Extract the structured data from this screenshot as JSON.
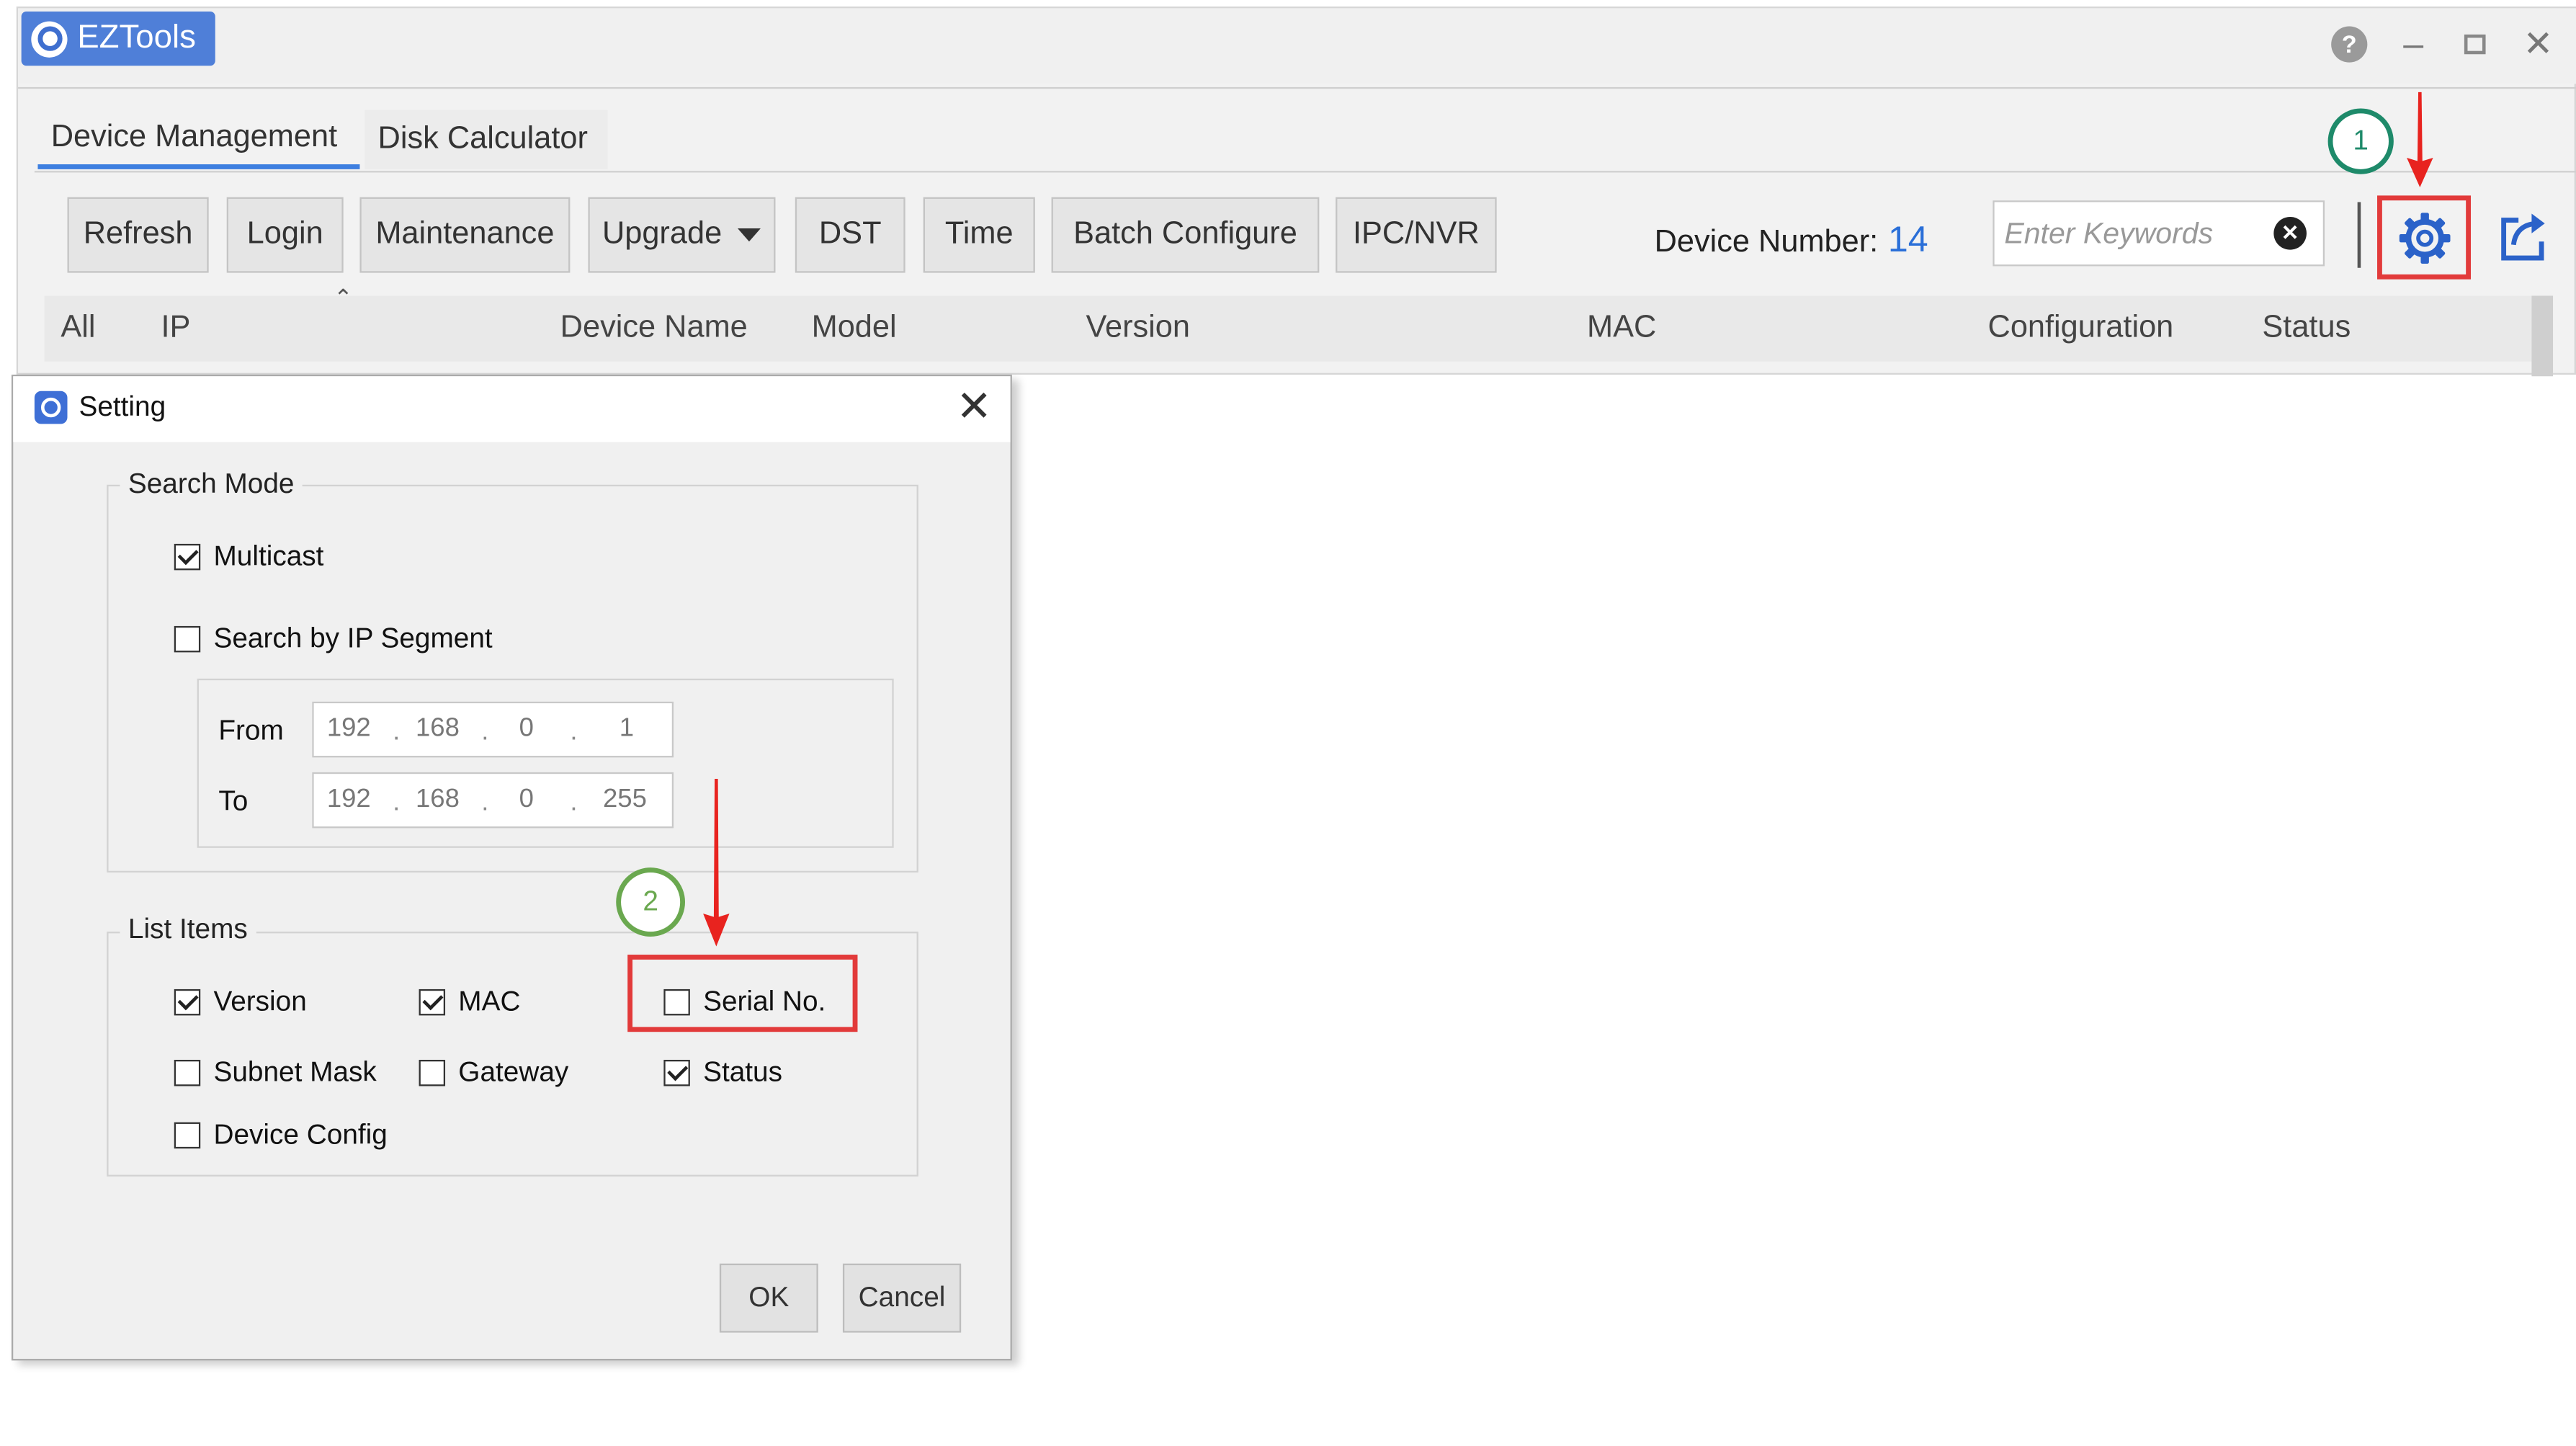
{
  "app": {
    "title": "EZTools"
  },
  "tabs": [
    {
      "label": "Device Management",
      "active": true
    },
    {
      "label": "Disk Calculator",
      "active": false
    }
  ],
  "toolbar": {
    "refresh": "Refresh",
    "login": "Login",
    "maintenance": "Maintenance",
    "upgrade": "Upgrade",
    "dst": "DST",
    "time": "Time",
    "batch_configure": "Batch Configure",
    "ipc_nvr": "IPC/NVR",
    "device_number_label": "Device Number:",
    "device_number": "14",
    "search_placeholder": "Enter Keywords"
  },
  "columns": [
    "All",
    "IP",
    "Device Name",
    "Model",
    "Version",
    "MAC",
    "Configuration",
    "Status"
  ],
  "dialog": {
    "title": "Setting",
    "search_mode": {
      "legend": "Search Mode",
      "multicast": {
        "label": "Multicast",
        "checked": true
      },
      "by_ip_segment": {
        "label": "Search by IP Segment",
        "checked": false
      },
      "from_label": "From",
      "to_label": "To",
      "from": [
        "192",
        "168",
        "0",
        "1"
      ],
      "to": [
        "192",
        "168",
        "0",
        "255"
      ]
    },
    "list_items": {
      "legend": "List Items",
      "items": [
        {
          "label": "Version",
          "checked": true
        },
        {
          "label": "MAC",
          "checked": true
        },
        {
          "label": "Serial No.",
          "checked": false
        },
        {
          "label": "Subnet Mask",
          "checked": false
        },
        {
          "label": "Gateway",
          "checked": false
        },
        {
          "label": "Status",
          "checked": true
        },
        {
          "label": "Device Config",
          "checked": false
        }
      ]
    },
    "ok": "OK",
    "cancel": "Cancel"
  },
  "annotations": {
    "step1": "1",
    "step2": "2"
  },
  "colors": {
    "accent": "#4f7fd8",
    "highlight": "#e23a3a",
    "step1": "#1e8a6a",
    "step2": "#6aa84f",
    "device_number": "#2a6fd8"
  }
}
